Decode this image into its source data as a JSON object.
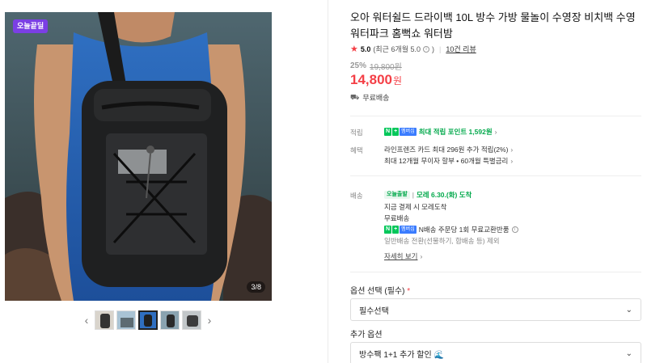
{
  "image": {
    "badge": "오늘끝딜",
    "counter": "3/8",
    "thumb_count": 5,
    "active_thumb_index": 2
  },
  "product": {
    "title": "오아 워터쉴드 드라이백 10L 방수 가방 물놀이 수영장 비치백 수영 워터파크 홈뻑쇼 워터밤",
    "rating": "5.0",
    "rating_detail": "(최근 6개월 5.0",
    "rating_info_icon": "info-circle-icon",
    "review_link": "10건 리뷰",
    "discount_rate": "25%",
    "original_price": "19,800원",
    "price": "14,800",
    "price_unit": "원",
    "shipping_summary": "무료배송"
  },
  "benefits": {
    "points_label": "적립",
    "points_text": "최대 적립 포인트 1,592원",
    "perks_label": "혜택",
    "perks_line1": "라인프렌즈 카드 최대 296원 추가 적립(2%)",
    "perks_line2": "최대 12개월 무이자 할부 • 60개월 특별금리"
  },
  "delivery": {
    "label": "배송",
    "today_badge": "오늘출발",
    "eta": "모레 6.30.(화) 도착",
    "line2": "지금 결제 시 모레도착",
    "line3": "무료배송",
    "line4": "N배송 주문당 1회 무료교환반품",
    "line5": "일반배송 전환(선물하기, 합배송 등) 제외",
    "more": "자세히 보기"
  },
  "npay": {
    "n": "N",
    "plus": "+",
    "membership": "멤버십"
  },
  "options": {
    "select_label": "옵션 선택",
    "required": "(필수)",
    "required_mark": "*",
    "select_value": "필수선택",
    "add_label": "추가 옵션",
    "add_value": "방수팩 1+1 추가 할인"
  },
  "colors": {
    "accent": "#f43f46",
    "npay_green": "#03c75a",
    "badge_purple": "#7b3fe4"
  }
}
